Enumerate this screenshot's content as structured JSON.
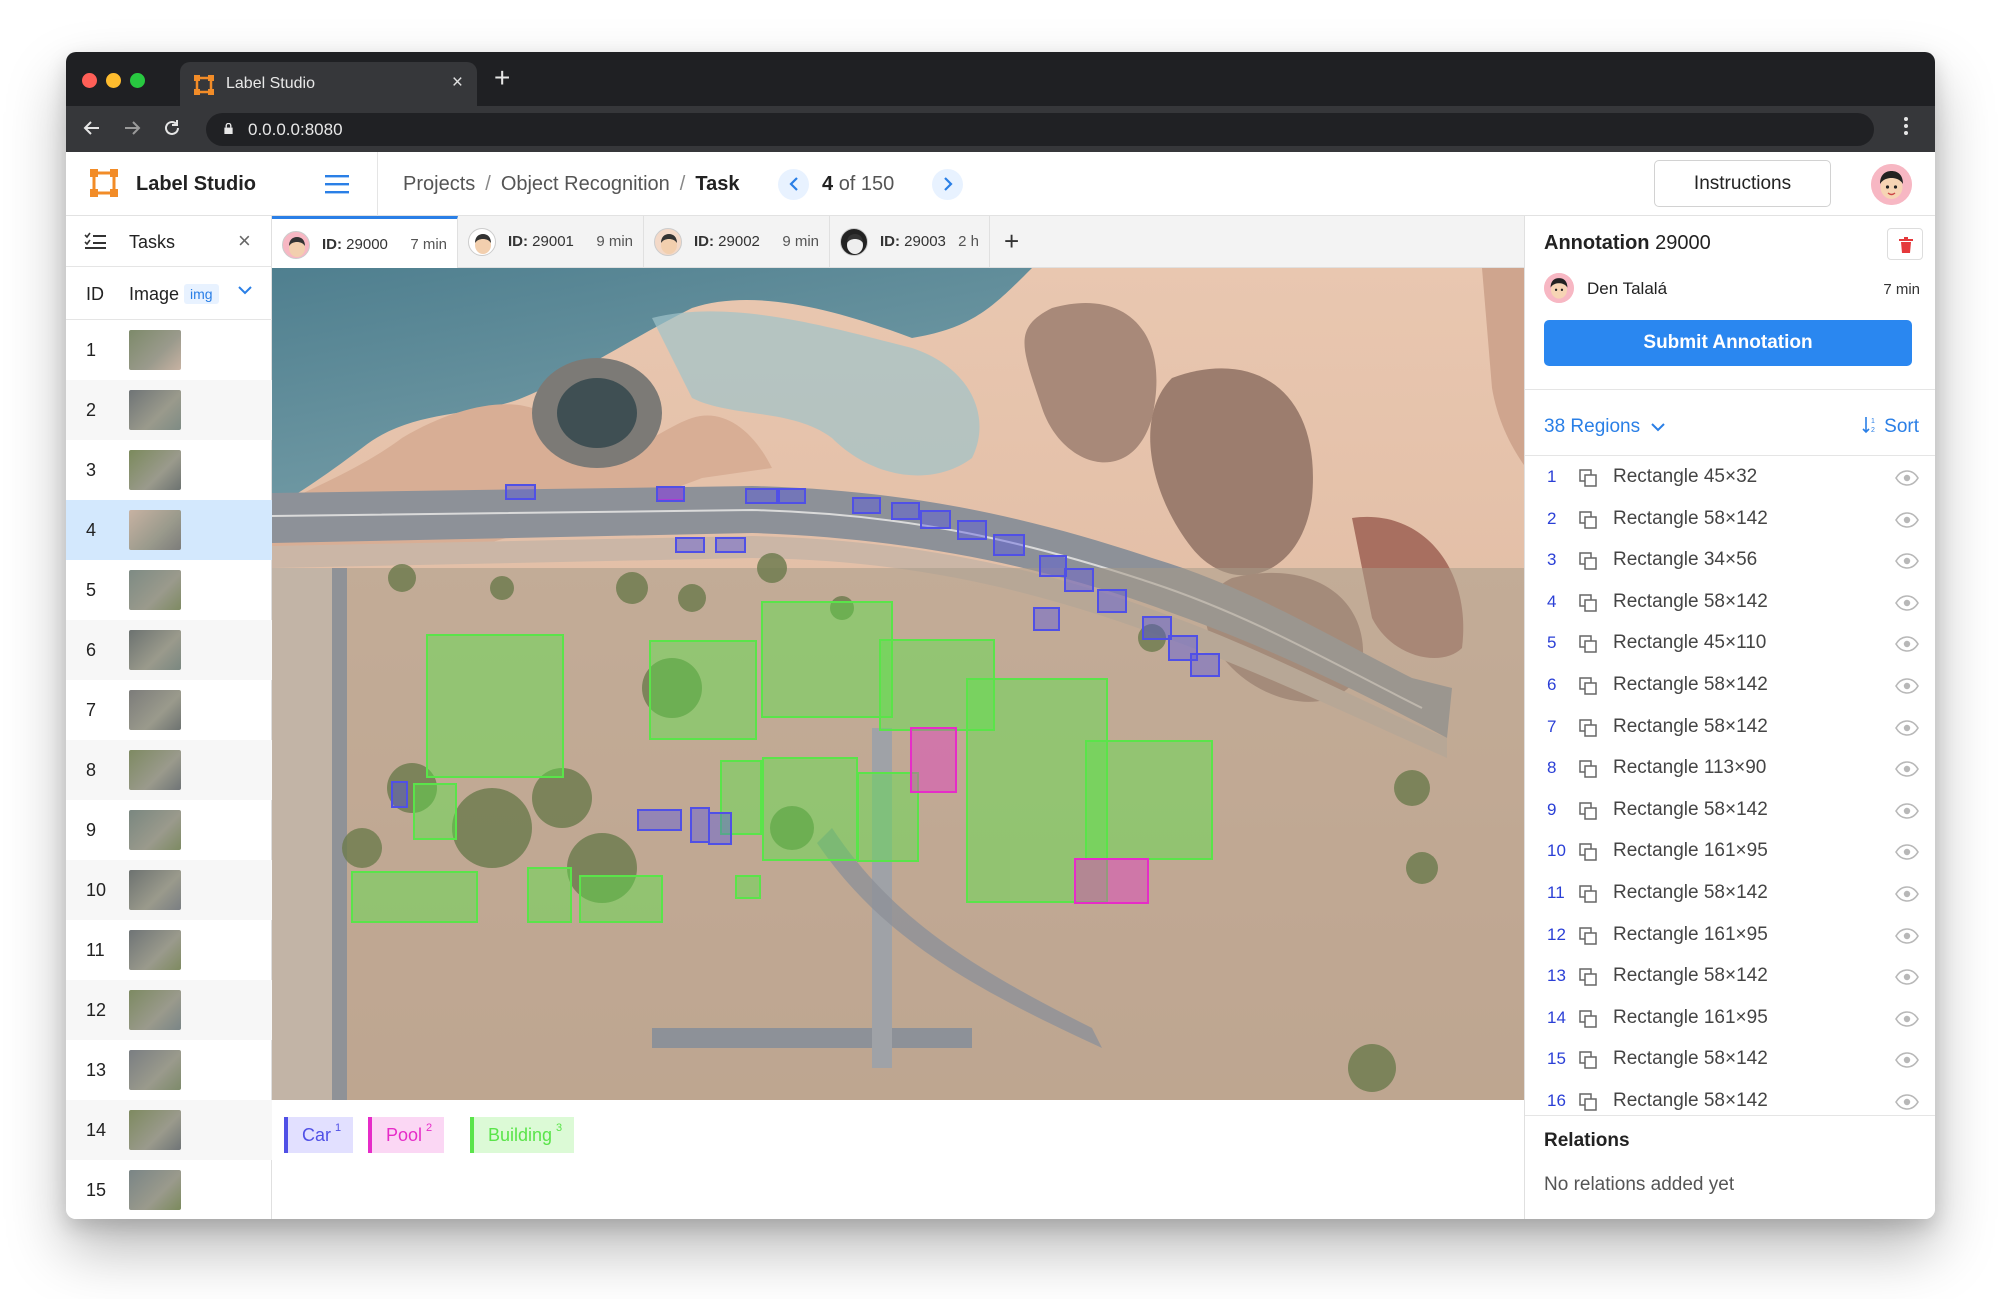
{
  "browser": {
    "tab_title": "Label Studio",
    "tab_close": "×",
    "new_tab": "+",
    "url": "0.0.0.0:8080"
  },
  "header": {
    "brand": "Label Studio",
    "crumbs": [
      "Projects",
      "Object Recognition",
      "Task"
    ],
    "separator": "/",
    "pager_current": "4",
    "pager_rest": "of 150",
    "instructions": "Instructions"
  },
  "tasks": {
    "title": "Tasks",
    "close": "×",
    "col_id": "ID",
    "col_image": "Image",
    "col_badge": "img",
    "selected": 4,
    "rows": [
      "1",
      "2",
      "3",
      "4",
      "5",
      "6",
      "7",
      "8",
      "9",
      "10",
      "11",
      "12",
      "13",
      "14",
      "15"
    ]
  },
  "annotation_tabs": [
    {
      "id_label": "ID:",
      "id": "29000",
      "time": "7 min",
      "active": true
    },
    {
      "id_label": "ID:",
      "id": "29001",
      "time": "9 min",
      "active": false
    },
    {
      "id_label": "ID:",
      "id": "29002",
      "time": "9 min",
      "active": false
    },
    {
      "id_label": "ID:",
      "id": "29003",
      "time": "2 h",
      "active": false
    }
  ],
  "add_tab": "+",
  "labels": [
    {
      "name": "Car",
      "hotkey": "1",
      "color": "#5050e6",
      "bg": "#e2e0ff"
    },
    {
      "name": "Pool",
      "hotkey": "2",
      "color": "#e62cc8",
      "bg": "#fbd7f4"
    },
    {
      "name": "Building",
      "hotkey": "3",
      "color": "#5ae44a",
      "bg": "#dcfad6"
    }
  ],
  "annotation": {
    "title_prefix": "Annotation",
    "id": "29000",
    "author": "Den Talalá",
    "time": "7 min",
    "submit": "Submit Annotation",
    "regions_label": "38 Regions",
    "sort_label": "Sort",
    "regions": [
      {
        "n": "1",
        "name": "Rectangle 45×32"
      },
      {
        "n": "2",
        "name": "Rectangle 58×142"
      },
      {
        "n": "3",
        "name": "Rectangle 34×56"
      },
      {
        "n": "4",
        "name": "Rectangle 58×142"
      },
      {
        "n": "5",
        "name": "Rectangle 45×110"
      },
      {
        "n": "6",
        "name": "Rectangle 58×142"
      },
      {
        "n": "7",
        "name": "Rectangle 58×142"
      },
      {
        "n": "8",
        "name": "Rectangle 113×90"
      },
      {
        "n": "9",
        "name": "Rectangle 58×142"
      },
      {
        "n": "10",
        "name": "Rectangle 161×95"
      },
      {
        "n": "11",
        "name": "Rectangle 58×142"
      },
      {
        "n": "12",
        "name": "Rectangle 161×95"
      },
      {
        "n": "13",
        "name": "Rectangle 58×142"
      },
      {
        "n": "14",
        "name": "Rectangle 161×95"
      },
      {
        "n": "15",
        "name": "Rectangle 58×142"
      },
      {
        "n": "16",
        "name": "Rectangle 58×142"
      }
    ],
    "relations_title": "Relations",
    "relations_empty": "No relations added yet"
  },
  "colors": {
    "accent": "#2a87f0",
    "car": "#5050e6",
    "pool": "#e62cc8",
    "building": "#5ae44a"
  }
}
